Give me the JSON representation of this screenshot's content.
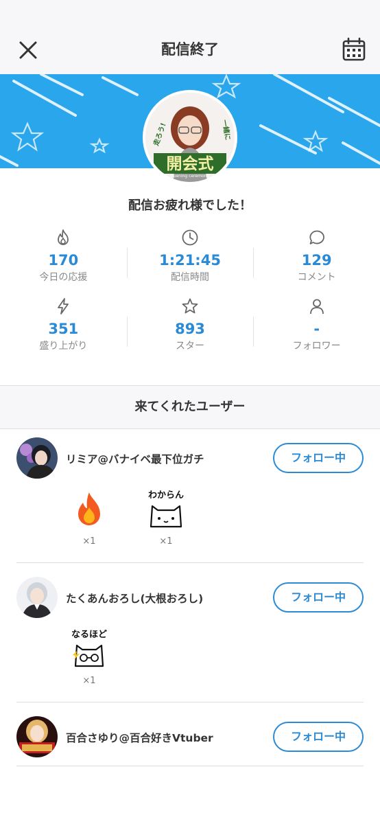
{
  "header": {
    "title": "配信終了",
    "close_icon": "close-icon",
    "calendar_icon": "calendar-icon"
  },
  "banner": {
    "color": "#2aa6ec",
    "avatar_caption": "開会式",
    "avatar_side_left": "走ろう!",
    "avatar_side_right": "一緒に",
    "avatar_sub": "opening ceremony"
  },
  "message": "配信お疲れ様でした！",
  "stats": [
    {
      "icon": "flame-icon",
      "value": "170",
      "label": "今日の応援"
    },
    {
      "icon": "clock-icon",
      "value": "1:21:45",
      "label": "配信時間"
    },
    {
      "icon": "comment-icon",
      "value": "129",
      "label": "コメント"
    },
    {
      "icon": "lightning-icon",
      "value": "351",
      "label": "盛り上がり"
    },
    {
      "icon": "star-icon",
      "value": "893",
      "label": "スター"
    },
    {
      "icon": "person-icon",
      "value": "-",
      "label": "フォロワー"
    }
  ],
  "accent_color": "#2a8ad6",
  "section_title": "来てくれたユーザー",
  "users": [
    {
      "name": "リミア@バナイベ最下位ガチ",
      "button": "フォロー中",
      "stamps": [
        {
          "icon": "fire-stamp-icon",
          "count": "×1"
        },
        {
          "icon": "wakaran-cat-stamp-icon",
          "text": "わからん",
          "count": "×1"
        }
      ]
    },
    {
      "name": "たくあんおろし(大根おろし)",
      "button": "フォロー中",
      "stamps": [
        {
          "icon": "naruhodo-cat-stamp-icon",
          "text": "なるほど",
          "count": "×1"
        }
      ]
    },
    {
      "name": "百合さゆり@百合好きVtuber",
      "button": "フォロー中",
      "stamps": []
    }
  ]
}
